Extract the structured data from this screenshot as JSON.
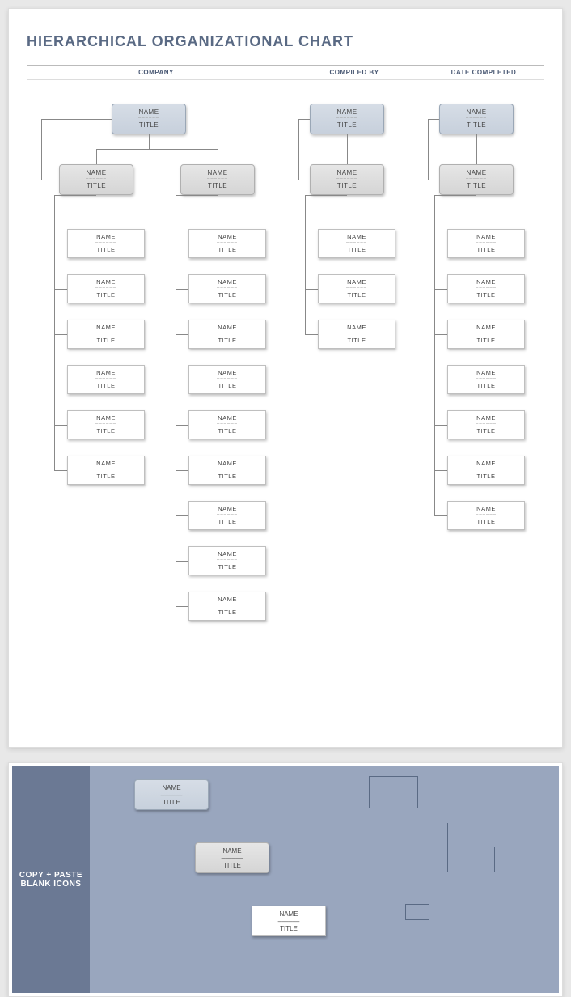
{
  "title": "HIERARCHICAL ORGANIZATIONAL CHART",
  "headers": {
    "company": "COMPANY",
    "compiled": "COMPILED BY",
    "date": "DATE COMPLETED"
  },
  "placeholder": {
    "name": "NAME",
    "title": "TITLE",
    "sep": "––––––"
  },
  "palette_label": "COPY + PASTE\nBLANK ICONS",
  "chart_data": {
    "type": "org-chart",
    "branches": [
      {
        "head": {
          "name": "NAME",
          "title": "TITLE",
          "style": "blue"
        },
        "managers": [
          {
            "name": "NAME",
            "title": "TITLE",
            "style": "grey",
            "reports": [
              {
                "name": "NAME",
                "title": "TITLE"
              },
              {
                "name": "NAME",
                "title": "TITLE"
              },
              {
                "name": "NAME",
                "title": "TITLE"
              },
              {
                "name": "NAME",
                "title": "TITLE"
              },
              {
                "name": "NAME",
                "title": "TITLE"
              },
              {
                "name": "NAME",
                "title": "TITLE"
              }
            ]
          },
          {
            "name": "NAME",
            "title": "TITLE",
            "style": "grey",
            "reports": [
              {
                "name": "NAME",
                "title": "TITLE"
              },
              {
                "name": "NAME",
                "title": "TITLE"
              },
              {
                "name": "NAME",
                "title": "TITLE"
              },
              {
                "name": "NAME",
                "title": "TITLE"
              },
              {
                "name": "NAME",
                "title": "TITLE"
              },
              {
                "name": "NAME",
                "title": "TITLE"
              },
              {
                "name": "NAME",
                "title": "TITLE"
              },
              {
                "name": "NAME",
                "title": "TITLE"
              },
              {
                "name": "NAME",
                "title": "TITLE"
              }
            ]
          }
        ]
      },
      {
        "head": {
          "name": "NAME",
          "title": "TITLE",
          "style": "blue"
        },
        "managers": [
          {
            "name": "NAME",
            "title": "TITLE",
            "style": "grey",
            "reports": [
              {
                "name": "NAME",
                "title": "TITLE"
              },
              {
                "name": "NAME",
                "title": "TITLE"
              },
              {
                "name": "NAME",
                "title": "TITLE"
              }
            ]
          }
        ]
      },
      {
        "head": {
          "name": "NAME",
          "title": "TITLE",
          "style": "blue"
        },
        "managers": [
          {
            "name": "NAME",
            "title": "TITLE",
            "style": "grey",
            "reports": [
              {
                "name": "NAME",
                "title": "TITLE"
              },
              {
                "name": "NAME",
                "title": "TITLE"
              },
              {
                "name": "NAME",
                "title": "TITLE"
              },
              {
                "name": "NAME",
                "title": "TITLE"
              },
              {
                "name": "NAME",
                "title": "TITLE"
              },
              {
                "name": "NAME",
                "title": "TITLE"
              },
              {
                "name": "NAME",
                "title": "TITLE"
              }
            ]
          }
        ]
      }
    ]
  }
}
